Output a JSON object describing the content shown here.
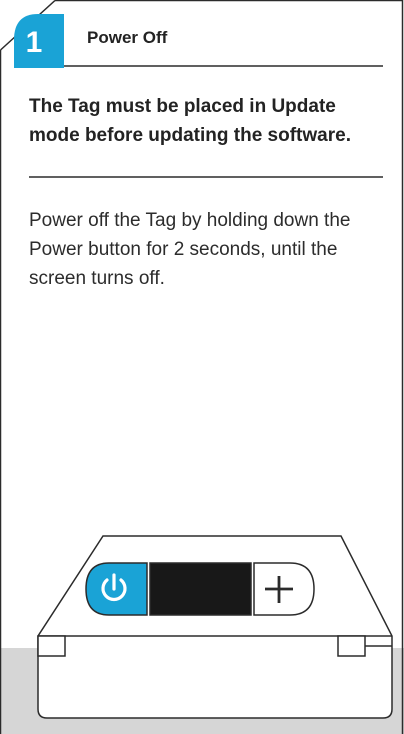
{
  "step": {
    "number": "1",
    "title": "Power Off"
  },
  "warning_text": "The Tag must be placed in Update mode before updating the software.",
  "instruction_text": "Power off the Tag by holding down the Power button for 2 seconds, until the screen turns off.",
  "device": {
    "power_button_icon": "power-icon",
    "plus_button_icon": "plus-icon"
  },
  "colors": {
    "accent": "#1aa3d6",
    "text": "#232323",
    "screen": "#181818",
    "background_panel": "#d6d6d6"
  }
}
